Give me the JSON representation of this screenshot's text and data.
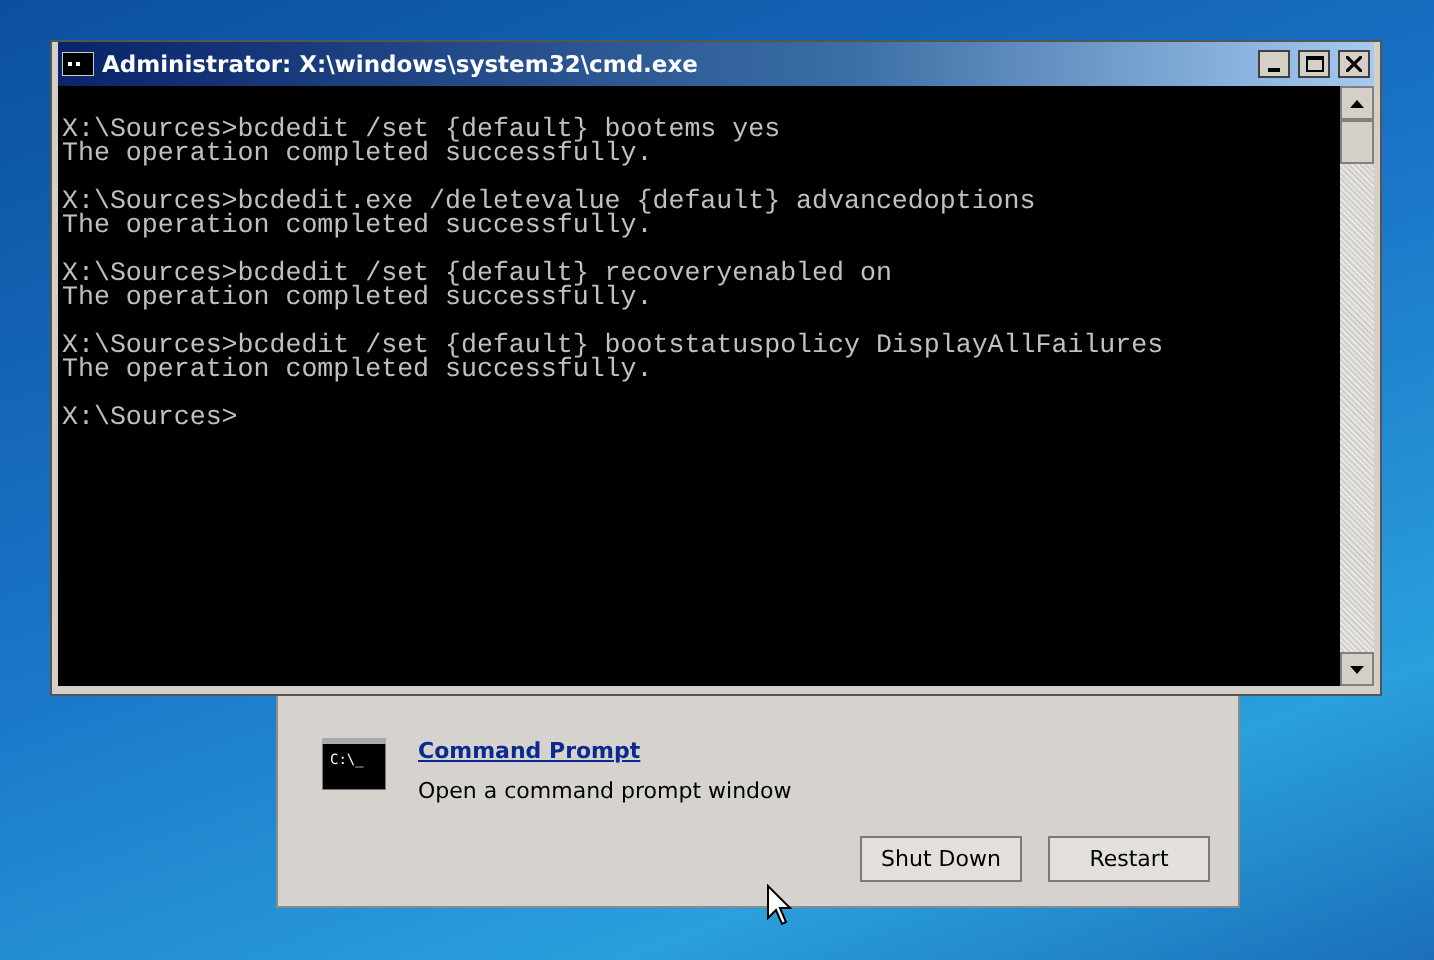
{
  "window": {
    "title": "Administrator: X:\\windows\\system32\\cmd.exe"
  },
  "console": {
    "blocks": [
      {
        "command": "X:\\Sources>bcdedit /set {default} bootems yes",
        "result": "The operation completed successfully."
      },
      {
        "command": "X:\\Sources>bcdedit.exe /deletevalue {default} advancedoptions",
        "result": "The operation completed successfully."
      },
      {
        "command": "X:\\Sources>bcdedit /set {default} recoveryenabled on",
        "result": "The operation completed successfully."
      },
      {
        "command": "X:\\Sources>bcdedit /set {default} bootstatuspolicy DisplayAllFailures",
        "result": "The operation completed successfully."
      }
    ],
    "prompt": "X:\\Sources>"
  },
  "recovery_dialog": {
    "option": {
      "icon_text": "C:\\_",
      "title": "Command Prompt",
      "description": "Open a command prompt window"
    },
    "buttons": [
      "Shut Down",
      "Restart"
    ]
  }
}
